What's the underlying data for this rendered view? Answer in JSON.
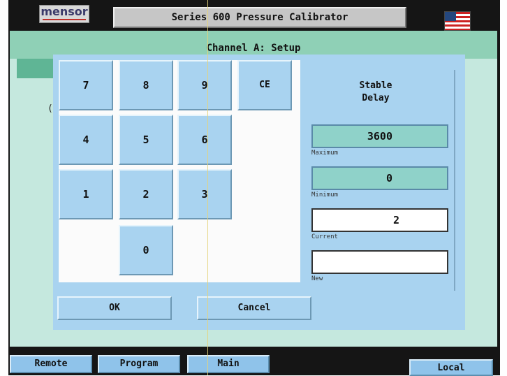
{
  "app": {
    "brand": "mensor",
    "title": "Series 600 Pressure Calibrator",
    "flag_icon": "us-flag-icon"
  },
  "header": {
    "title": "Channel A: Setup"
  },
  "background": {
    "partial_text": "("
  },
  "keypad": {
    "keys": [
      "7",
      "8",
      "9",
      "CE",
      "4",
      "5",
      "6",
      "1",
      "2",
      "3",
      "0"
    ]
  },
  "setting": {
    "title_line1": "Stable",
    "title_line2": "Delay",
    "maximum": {
      "value": "3600",
      "label": "Maximum"
    },
    "minimum": {
      "value": "0",
      "label": "Minimum"
    },
    "current": {
      "value": "2",
      "label": "Current"
    },
    "new": {
      "value": "",
      "label": "New"
    }
  },
  "dialog": {
    "ok_label": "OK",
    "cancel_label": "Cancel"
  },
  "nav": {
    "remote": "Remote",
    "program": "Program",
    "main": "Main",
    "local": "Local"
  },
  "colors": {
    "panel": "#a9d3f0",
    "header": "#8fd0b6",
    "background": "#c5e8de",
    "frame": "#151515"
  }
}
